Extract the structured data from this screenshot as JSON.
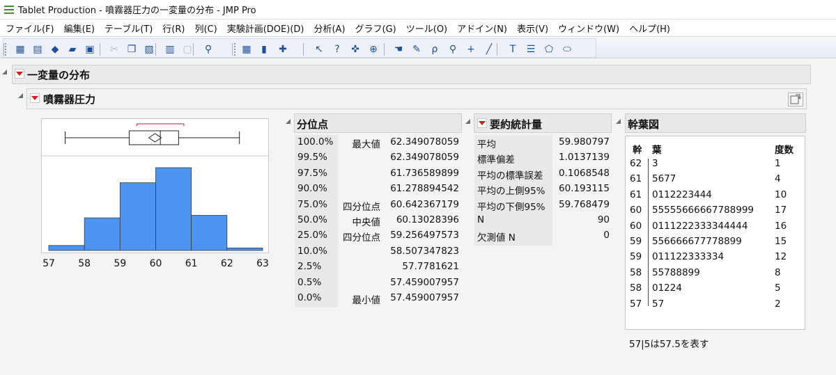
{
  "window": {
    "title": "Tablet Production - 噴霧器圧力の一変量の分布 - JMP Pro"
  },
  "menu": [
    "ファイル(F)",
    "編集(E)",
    "テーブル(T)",
    "行(R)",
    "列(C)",
    "実験計画(DOE)(D)",
    "分析(A)",
    "グラフ(G)",
    "ツール(O)",
    "アドイン(N)",
    "表示(V)",
    "ウィンドウ(W)",
    "ヘルプ(H)"
  ],
  "toolbar": {
    "icons": [
      "new-data-table-icon",
      "new-script-icon",
      "python-icon",
      "open-folder-icon",
      "save-icon",
      "cut-icon",
      "copy-icon",
      "paste-icon",
      "journal-icon",
      "lock-icon",
      "search-icon",
      "data-grid-icon",
      "distribution-icon",
      "add-table-icon",
      "arrow-tool-icon",
      "help-tool-icon",
      "selection-tool-icon",
      "crosshair-tool-icon",
      "hand-tool-icon",
      "brush-tool-icon",
      "lasso-tool-icon",
      "magnifier-tool-icon",
      "plus-tool-icon",
      "line-tool-icon",
      "annotate-tool-icon",
      "simple-shape-tool-icon",
      "polygon-tool-icon",
      "oval-tool-icon"
    ]
  },
  "report": {
    "outline_title": "一変量の分布",
    "variable_title": "噴霧器圧力",
    "quantiles_title": "分位点",
    "summary_title": "要約統計量",
    "stem_title": "幹葉図"
  },
  "histogram": {
    "x_ticks": [
      "57",
      "58",
      "59",
      "60",
      "61",
      "62",
      "63"
    ],
    "x_range": [
      57,
      63
    ],
    "bins": [
      {
        "from": 57,
        "to": 58,
        "count": 2
      },
      {
        "from": 58,
        "to": 59,
        "count": 13
      },
      {
        "from": 59,
        "to": 60,
        "count": 27
      },
      {
        "from": 60,
        "to": 61,
        "count": 33
      },
      {
        "from": 61,
        "to": 62,
        "count": 14
      },
      {
        "from": 62,
        "to": 63,
        "count": 1
      }
    ],
    "bar_color": "#4d94f0",
    "box": {
      "min": 57.459007957,
      "q1": 59.256497573,
      "median": 60.13028396,
      "q3": 60.642367179,
      "max": 62.349078059,
      "mean": 59.980797
    }
  },
  "quantiles": [
    {
      "pct": "100.0%",
      "label": "最大値",
      "value": "62.349078059"
    },
    {
      "pct": "99.5%",
      "label": "",
      "value": "62.349078059"
    },
    {
      "pct": "97.5%",
      "label": "",
      "value": "61.736589899"
    },
    {
      "pct": "90.0%",
      "label": "",
      "value": "61.278894542"
    },
    {
      "pct": "75.0%",
      "label": "四分位点",
      "value": "60.642367179"
    },
    {
      "pct": "50.0%",
      "label": "中央値",
      "value": "60.13028396"
    },
    {
      "pct": "25.0%",
      "label": "四分位点",
      "value": "59.256497573"
    },
    {
      "pct": "10.0%",
      "label": "",
      "value": "58.507347823"
    },
    {
      "pct": "2.5%",
      "label": "",
      "value": "57.7781621"
    },
    {
      "pct": "0.5%",
      "label": "",
      "value": "57.459007957"
    },
    {
      "pct": "0.0%",
      "label": "最小値",
      "value": "57.459007957"
    }
  ],
  "summary": [
    {
      "label": "平均",
      "value": "59.980797"
    },
    {
      "label": "標準偏差",
      "value": "1.0137139"
    },
    {
      "label": "平均の標準誤差",
      "value": "0.1068548"
    },
    {
      "label": "平均の上側95%",
      "value": "60.193115"
    },
    {
      "label": "平均の下側95%",
      "value": "59.768479"
    },
    {
      "label": "N",
      "value": "90"
    },
    {
      "label": "欠測値 N",
      "value": "0"
    }
  ],
  "stem_leaf": {
    "headers": {
      "stem": "幹",
      "leaf": "葉",
      "count": "度数"
    },
    "rows": [
      {
        "stem": "62",
        "leaf": "3",
        "count": "1"
      },
      {
        "stem": "61",
        "leaf": "5677",
        "count": "4"
      },
      {
        "stem": "61",
        "leaf": "0112223444",
        "count": "10"
      },
      {
        "stem": "60",
        "leaf": "55555666667788999",
        "count": "17"
      },
      {
        "stem": "60",
        "leaf": "0111222333344444",
        "count": "16"
      },
      {
        "stem": "59",
        "leaf": "556666677778899",
        "count": "15"
      },
      {
        "stem": "59",
        "leaf": "011122333334",
        "count": "12"
      },
      {
        "stem": "58",
        "leaf": "55788899",
        "count": "8"
      },
      {
        "stem": "58",
        "leaf": "01224",
        "count": "5"
      },
      {
        "stem": "57",
        "leaf": "57",
        "count": "2"
      }
    ],
    "note": "57|5は57.5を表す"
  }
}
